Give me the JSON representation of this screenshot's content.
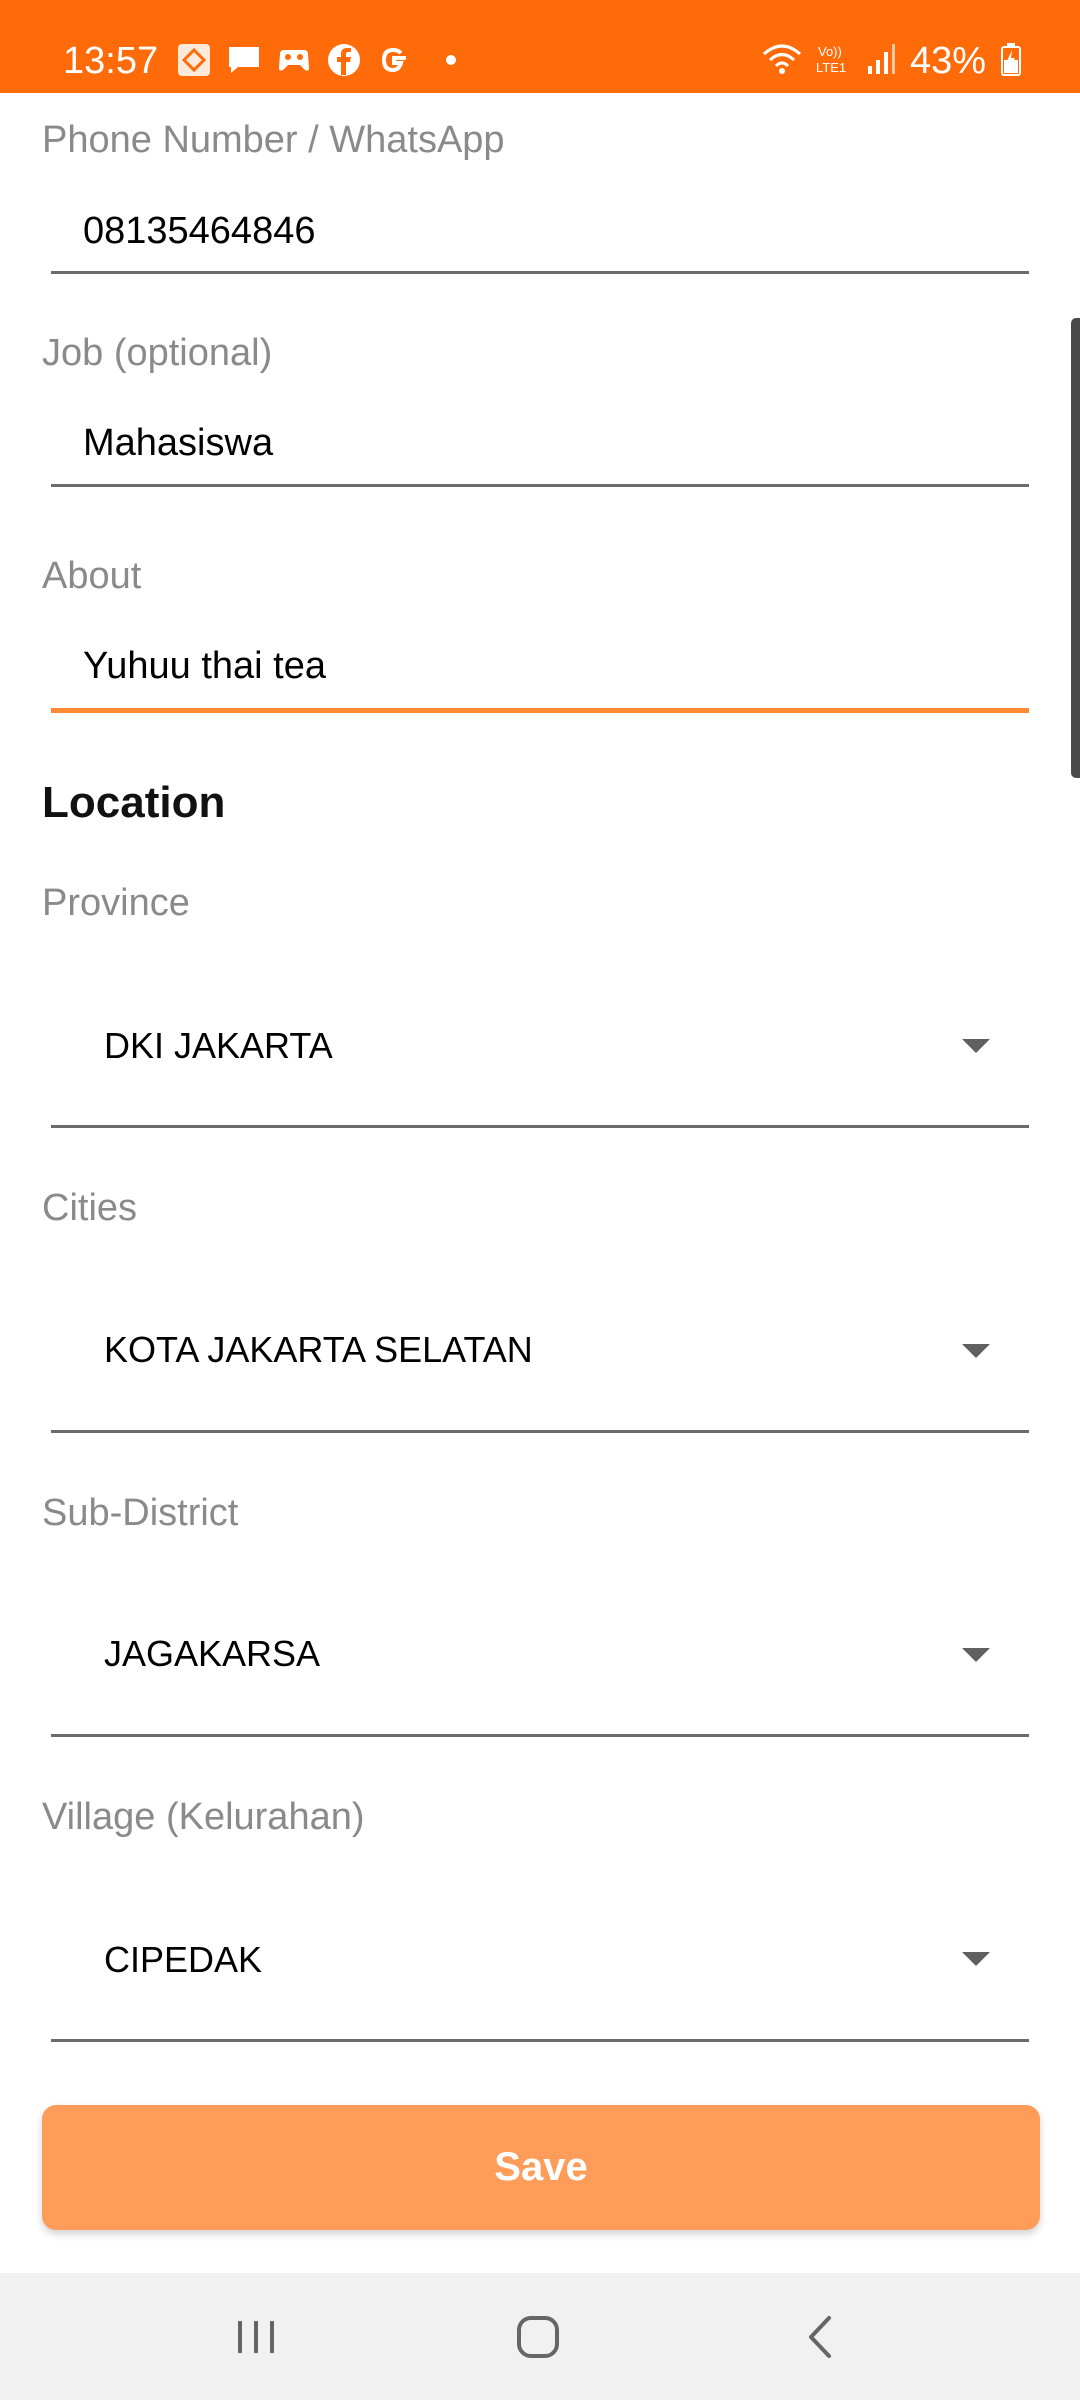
{
  "status_bar": {
    "time": "13:57",
    "battery": "43%",
    "background_color": "#ff6b08",
    "left_icons": [
      "app-icon",
      "message-icon",
      "game-icon",
      "facebook-icon",
      "google-icon"
    ],
    "right_icons": [
      "wifi-icon",
      "volte-icon",
      "signal-icon",
      "battery-icon"
    ]
  },
  "form": {
    "phone": {
      "label": "Phone Number / WhatsApp",
      "value": "08135464846"
    },
    "job": {
      "label": "Job (optional)",
      "value": "Mahasiswa"
    },
    "about": {
      "label": "About",
      "value": "Yuhuu thai tea"
    },
    "location_title": "Location",
    "province": {
      "label": "Province",
      "value": "DKI JAKARTA"
    },
    "city": {
      "label": "Cities",
      "value": "KOTA JAKARTA SELATAN"
    },
    "sub_district": {
      "label": "Sub-District",
      "value": "JAGAKARSA"
    },
    "village": {
      "label": "Village (Kelurahan)",
      "value": "CIPEDAK"
    }
  },
  "save_button": {
    "label": "Save",
    "color": "#ff9c5a"
  },
  "accent_color": "#ff8a36",
  "nav_bar": {
    "buttons": [
      "recents-icon",
      "home-icon",
      "back-icon"
    ]
  }
}
